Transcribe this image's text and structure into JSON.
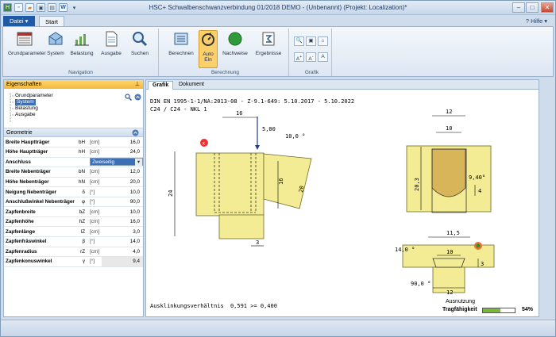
{
  "window": {
    "title": "HSC+ Schwalbenschwanzverbindung  01/2018 DEMO - (Unbenannt) (Projekt: Localization)*",
    "help_label": "Hilfe"
  },
  "tabs": {
    "file_label": "Datei",
    "start_label": "Start"
  },
  "ribbon": {
    "navigation": {
      "caption": "Navigation",
      "items": [
        "Grundparameter",
        "System",
        "Belastung",
        "Ausgabe",
        "Suchen"
      ]
    },
    "berechnung": {
      "caption": "Berechnung",
      "items": [
        "Berechnen",
        "Auto\nEin",
        "Nachweise",
        "Ergebnisse"
      ]
    },
    "grafik": {
      "caption": "Grafik"
    }
  },
  "properties": {
    "title": "Eigenschaften",
    "tree": [
      "Grundparameter",
      "System",
      "Belastung",
      "Ausgabe"
    ],
    "section": "Geometrie",
    "rows": [
      {
        "name": "Breite Hauptträger",
        "sym": "bH",
        "unit": "[cm]",
        "value": "16,0"
      },
      {
        "name": "Höhe Hauptträger",
        "sym": "hH",
        "unit": "[cm]",
        "value": "24,0"
      },
      {
        "name": "Anschluss",
        "sym": "",
        "unit": "",
        "value": "Zweiseitig"
      },
      {
        "name": "Breite Nebenträger",
        "sym": "bN",
        "unit": "[cm]",
        "value": "12,0"
      },
      {
        "name": "Höhe Nebenträger",
        "sym": "hN",
        "unit": "[cm]",
        "value": "20,0"
      },
      {
        "name": "Neigung Nebenträger",
        "sym": "δ",
        "unit": "[°]",
        "value": "10,0"
      },
      {
        "name": "Anschlußwinkel Nebenträger",
        "sym": "φ",
        "unit": "[°]",
        "value": "90,0"
      },
      {
        "name": "Zapfenbreite",
        "sym": "bZ",
        "unit": "[cm]",
        "value": "10,0"
      },
      {
        "name": "Zapfenhöhe",
        "sym": "hZ",
        "unit": "[cm]",
        "value": "16,0"
      },
      {
        "name": "Zapfenlänge",
        "sym": "lZ",
        "unit": "[cm]",
        "value": "3,0"
      },
      {
        "name": "Zapfenfräswinkel",
        "sym": "β",
        "unit": "[°]",
        "value": "14,0"
      },
      {
        "name": "Zapfenradius",
        "sym": "rZ",
        "unit": "[cm]",
        "value": "4,0"
      },
      {
        "name": "Zapfenkonuswinkel",
        "sym": "γ",
        "unit": "[°]",
        "value": "9,4"
      }
    ]
  },
  "doc_tabs": [
    "Grafik",
    "Dokument"
  ],
  "drawing": {
    "header1": "DIN EN 1995-1-1/NA:2013-08 - Z-9.1-649: 5.10.2017 - 5.10.2022",
    "header2": "C24 / C24 - NKL 1",
    "side": {
      "d16": "16",
      "load": "5,00",
      "angle": "10,0 °",
      "d24": "24",
      "d16b": "16",
      "d20": "20",
      "d3": "3"
    },
    "section": {
      "d12": "12",
      "d10": "10",
      "d20_3": "20,3",
      "r940": "9,40°",
      "d4": "4"
    },
    "top": {
      "d11_5": "11,5",
      "d14": "14,0 °",
      "d10": "10",
      "d12": "12",
      "d3": "3",
      "d90": "90,0 °"
    },
    "ratio_label": "Ausklinkungsverhältnis",
    "ratio_value": "0,591 >= 0,400",
    "utilization_label": "Ausnutzung",
    "capacity_label": "Tragfähigkeit",
    "capacity_value": "54%",
    "capacity_fraction": 0.54
  },
  "colors": {
    "wood": "#f3ec94",
    "wood_stroke": "#6b6b2a",
    "accent": "#1f5aa6",
    "bar": "#7ab83a"
  }
}
